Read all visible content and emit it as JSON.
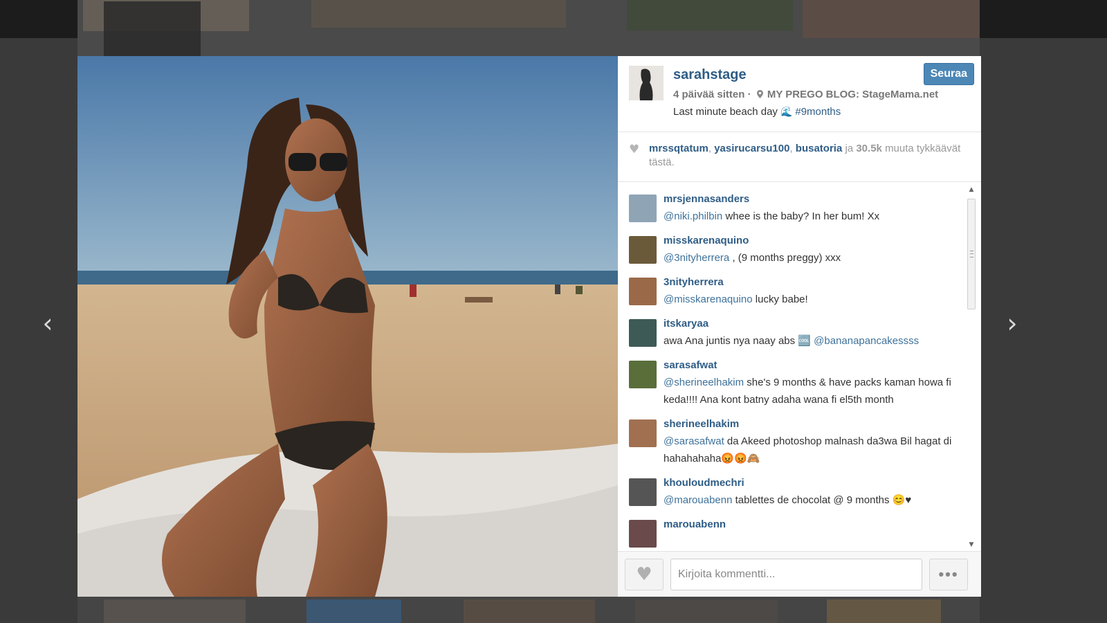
{
  "post": {
    "author": "sarahstage",
    "follow_label": "Seuraa",
    "time_ago": "4 päivää sitten",
    "separator": "·",
    "location": "MY PREGO BLOG: StageMama.net",
    "caption_text": "Last minute beach day",
    "caption_emoji": "🌊",
    "caption_hashtag": "#9months"
  },
  "likes": {
    "users": [
      "mrssqtatum",
      "yasirucarsu100",
      "busatoria"
    ],
    "connector": "ja",
    "count": "30.5k",
    "suffix": "muuta tykkäävät tästä."
  },
  "comments": [
    {
      "user": "mrsjennasanders",
      "mention": "@niki.philbin",
      "text": " whee is the baby? In her bum! Xx",
      "color": "#8fa5b5"
    },
    {
      "user": "misskarenaquino",
      "mention": "@3nityherrera",
      "text": " , (9 months preggy) xxx",
      "color": "#6b5a3a"
    },
    {
      "user": "3nityherrera",
      "mention": "@misskarenaquino",
      "text": " lucky babe!",
      "color": "#9a6a48"
    },
    {
      "user": "itskaryaa",
      "pre": "awa Ana juntis nya naay abs 🆒 ",
      "mention": "@bananapancakessss",
      "text": "",
      "color": "#3d5a56"
    },
    {
      "user": "sarasafwat",
      "mention": "@sherineelhakim",
      "text": " she's 9 months & have packs kaman howa fi keda!!!! Ana kont batny adaha wana fi el5th month",
      "color": "#5a6e3a"
    },
    {
      "user": "sherineelhakim",
      "mention": "@sarasafwat",
      "text": " da Akeed photoshop malnash da3wa Bil hagat di hahahahaha😡😡🙈",
      "color": "#a07050"
    },
    {
      "user": "khouloudmechri",
      "mention": "@marouabenn",
      "text": " tablettes de chocolat @ 9 months 😊♥",
      "color": "#555"
    },
    {
      "user": "marouabenn",
      "mention": "",
      "text": "",
      "color": "#6a4a4a"
    }
  ],
  "footer": {
    "comment_placeholder": "Kirjoita kommentti...",
    "more_label": "•••"
  },
  "nav": {
    "prev": "‹",
    "next": "›"
  }
}
